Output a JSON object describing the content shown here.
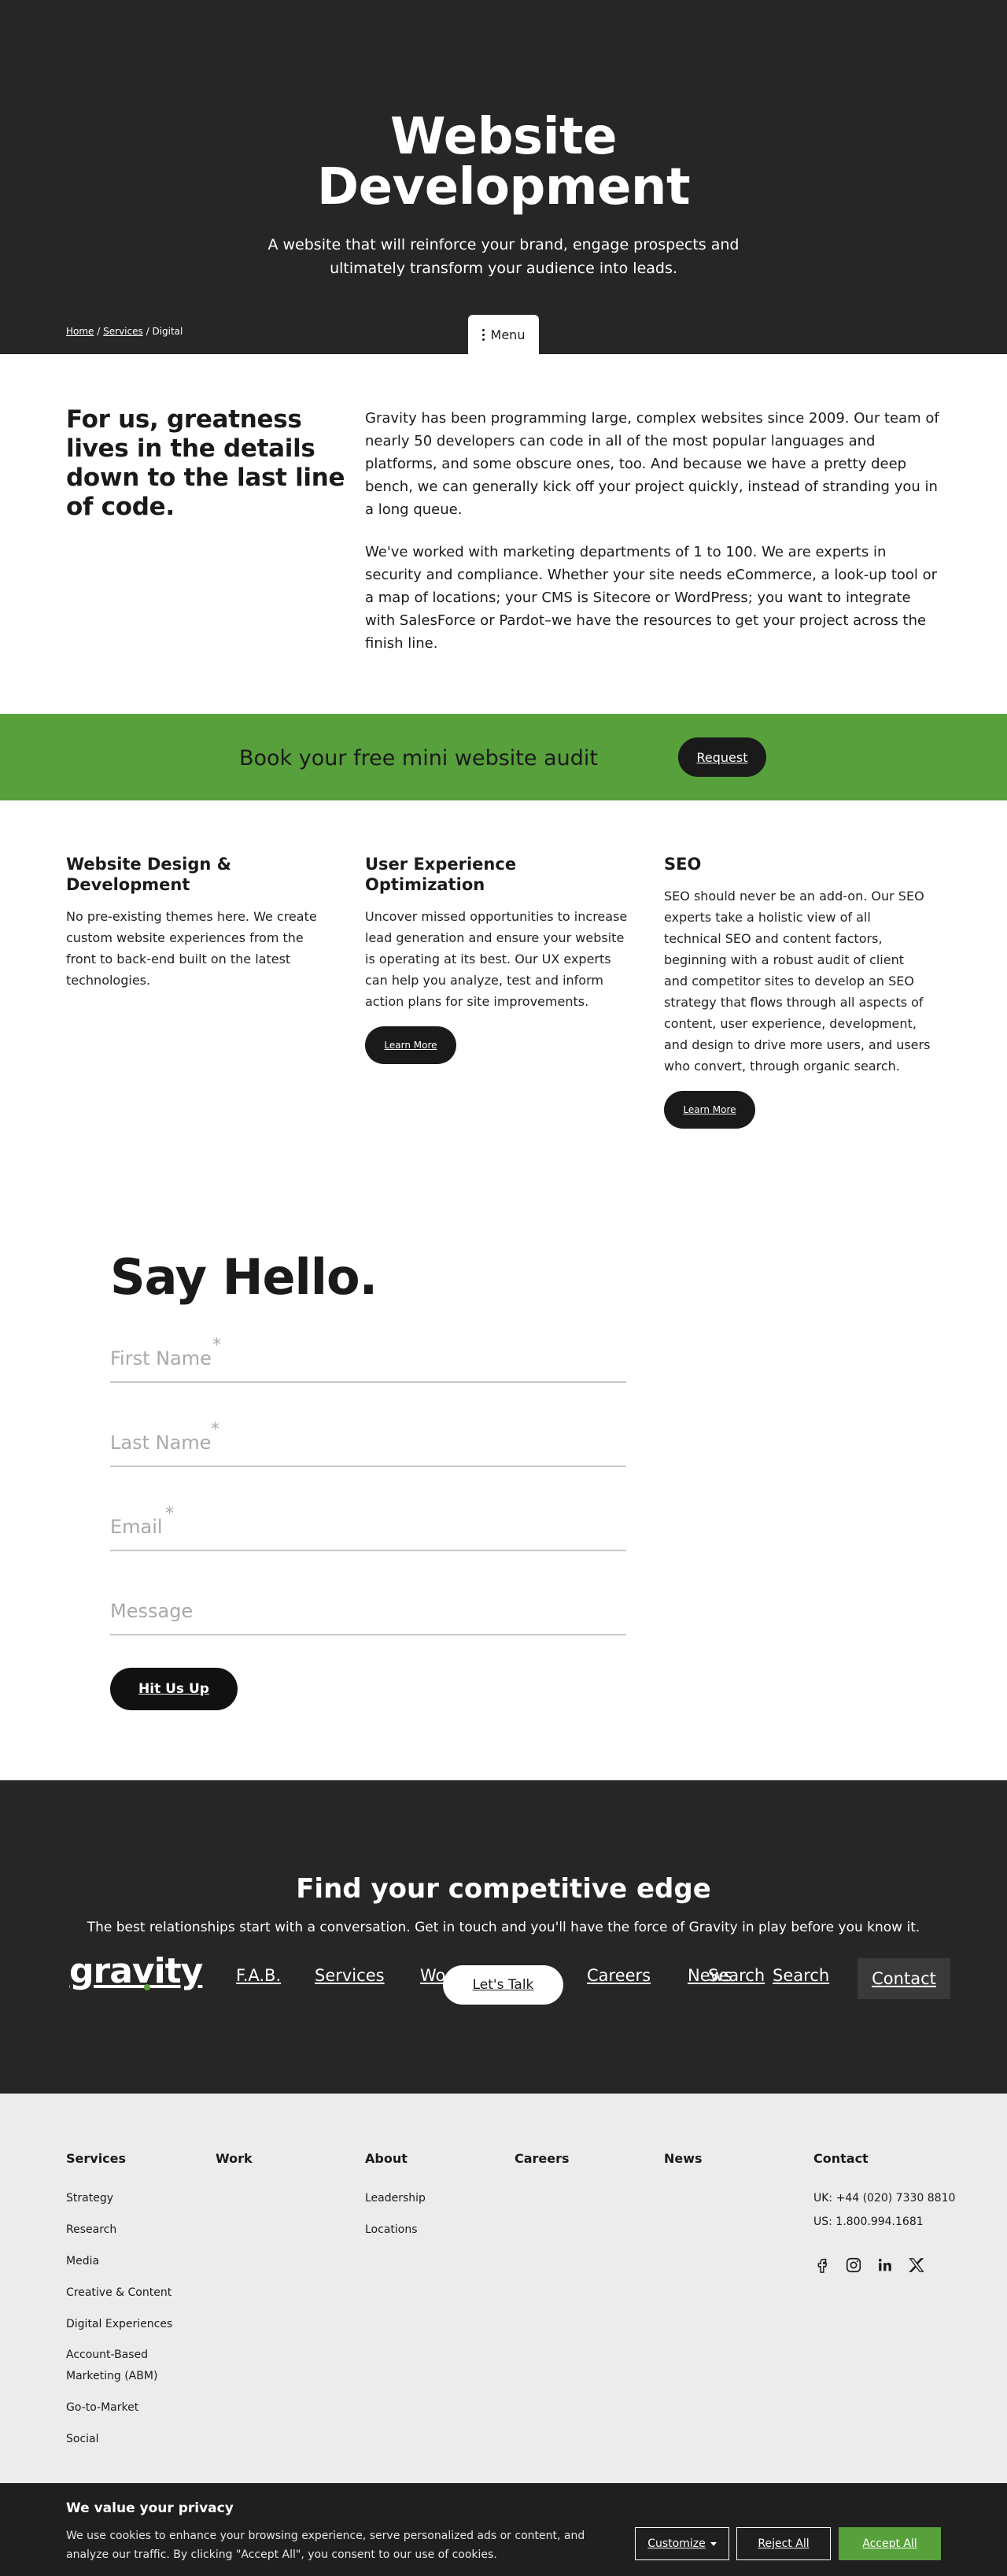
{
  "hero": {
    "title_line1": "Website",
    "title_line2": "Development",
    "subtitle": "A website that will reinforce your brand, engage prospects and ultimately transform your audience into leads."
  },
  "breadcrumb": {
    "home": "Home",
    "separator": "/",
    "services": "Services",
    "current": "Digital"
  },
  "menu_tab": {
    "label": "Menu"
  },
  "intro": {
    "heading": "For us, greatness lives in the details down to the last line of code.",
    "paragraph1": "Gravity has been programming large, complex websites since 2009. Our team of nearly 50 developers can code in all of the most popular languages and platforms, and some obscure ones, too. And because we have a pretty deep bench, we can generally kick off your project quickly, instead of stranding you in a long queue.",
    "paragraph2": "We've worked with marketing departments of 1 to 100. We are experts in security and compliance. Whether your site needs eCommerce, a look-up tool or a map of locations; your CMS is Sitecore or WordPress; you want to integrate with SalesForce or Pardot–we have the resources to get your project across the finish line."
  },
  "audit_band": {
    "text": "Book your free mini website audit",
    "button": "Request"
  },
  "services": [
    {
      "title": "Website Design & Development",
      "body": "No pre-existing themes here. We create custom website experiences from the front to back-end built on the latest technologies."
    },
    {
      "title": "User Experience Optimization",
      "body": "Uncover missed opportunities to increase lead generation and ensure your website is operating at its best. Our UX experts can help you analyze, test and inform action plans for site improvements.",
      "button": "Learn More"
    },
    {
      "title": "SEO",
      "body": "SEO should never be an add-on. Our SEO experts take a holistic view of all technical SEO and content factors, beginning with a robust audit of client and competitor sites to develop an SEO strategy that flows through all aspects of content, user experience, development, and design to drive more users, and users who convert, through organic search.",
      "button": "Learn More"
    }
  ],
  "contact_form": {
    "heading": "Say Hello.",
    "first_name_placeholder": "First Name",
    "last_name_placeholder": "Last Name",
    "email_placeholder": "Email",
    "message_placeholder": "Message",
    "required_mark": "*",
    "submit": "Hit Us Up"
  },
  "cta": {
    "heading": "Find your competitive edge",
    "text": "The best relationships start with a conversation. Get in touch and you'll have the force of Gravity in play before you know it."
  },
  "nav": {
    "logo": "gravity",
    "fab": "F.A.B.",
    "services": "Services",
    "work": "Wo",
    "lets_talk": "Let's Talk",
    "careers": "Careers",
    "news": "News",
    "search_overlap": "Search",
    "search": "Search",
    "contact": "Contact"
  },
  "footer": {
    "services_heading": "Services",
    "services_links": [
      "Strategy",
      "Research",
      "Media",
      "Creative & Content",
      "Digital Experiences",
      "Account-Based Marketing (ABM)",
      "Go-to-Market",
      "Social"
    ],
    "work_heading": "Work",
    "about_heading": "About",
    "about_links": [
      "Leadership",
      "Locations"
    ],
    "careers_heading": "Careers",
    "news_heading": "News",
    "contact_heading": "Contact",
    "phone_uk": "UK: +44 (020) 7330 8810",
    "phone_us": "US: 1.800.994.1681",
    "social_icons": [
      "facebook-icon",
      "instagram-icon",
      "linkedin-icon",
      "x-icon"
    ]
  },
  "cookie": {
    "title": "We value your privacy",
    "text": "We use cookies to enhance your browsing experience, serve personalized ads or content, and analyze our traffic. By clicking \"Accept All\", you consent to our use of cookies.",
    "customize": "Customize",
    "reject": "Reject All",
    "accept": "Accept All"
  },
  "colors": {
    "dark": "#262626",
    "accent_green": "#57a03b",
    "footer_bg": "#ececec",
    "cookie_bg": "#1f1f1f"
  }
}
